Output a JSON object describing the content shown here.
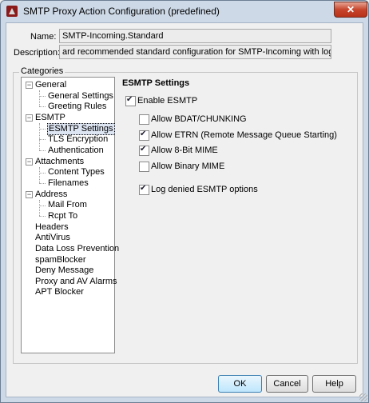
{
  "window": {
    "title": "SMTP Proxy Action Configuration (predefined)",
    "close_glyph": "✕"
  },
  "form": {
    "name_label": "Name:",
    "name_value": "SMTP-Incoming.Standard",
    "description_label": "Description:",
    "description_value": "ard recommended standard configuration for SMTP-Incoming with logging enabled"
  },
  "categories": {
    "legend": "Categories",
    "items": [
      {
        "label": "General",
        "children": [
          "General Settings",
          "Greeting Rules"
        ]
      },
      {
        "label": "ESMTP",
        "children": [
          "ESMTP Settings",
          "TLS Encryption",
          "Authentication"
        ],
        "selected": "ESMTP Settings"
      },
      {
        "label": "Attachments",
        "children": [
          "Content Types",
          "Filenames"
        ]
      },
      {
        "label": "Address",
        "children": [
          "Mail From",
          "Rcpt To"
        ]
      },
      {
        "label": "Headers"
      },
      {
        "label": "AntiVirus"
      },
      {
        "label": "Data Loss Prevention"
      },
      {
        "label": "spamBlocker"
      },
      {
        "label": "Deny Message"
      },
      {
        "label": "Proxy and AV Alarms"
      },
      {
        "label": "APT Blocker"
      }
    ]
  },
  "settings": {
    "heading": "ESMTP Settings",
    "enable_esmtp": {
      "label": "Enable ESMTP",
      "checked": true
    },
    "options": [
      {
        "label": "Allow BDAT/CHUNKING",
        "checked": false
      },
      {
        "label": "Allow ETRN (Remote Message Queue Starting)",
        "checked": true
      },
      {
        "label": "Allow 8-Bit MIME",
        "checked": true
      },
      {
        "label": "Allow Binary MIME",
        "checked": false
      }
    ],
    "log_denied": {
      "label": "Log denied ESMTP options",
      "checked": true
    }
  },
  "buttons": {
    "ok": "OK",
    "cancel": "Cancel",
    "help": "Help"
  }
}
